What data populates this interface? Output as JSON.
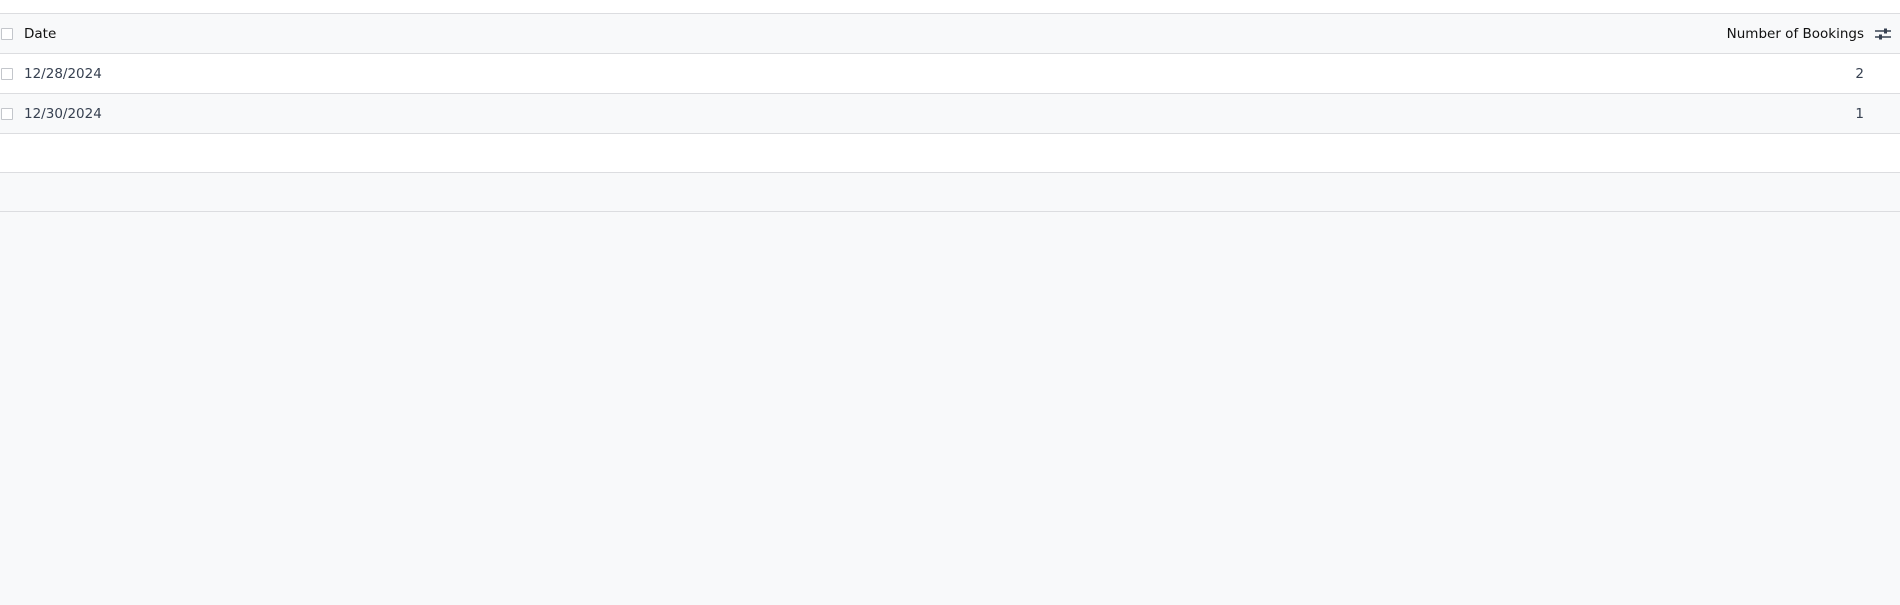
{
  "table": {
    "columns": {
      "date": "Date",
      "bookings": "Number of Bookings"
    },
    "rows": [
      {
        "date": "12/28/2024",
        "bookings": "2"
      },
      {
        "date": "12/30/2024",
        "bookings": "1"
      }
    ]
  },
  "icons": {
    "header_select": "checkbox-icon",
    "column_options": "sliders-icon"
  },
  "colors": {
    "background": "#f8f9fa",
    "row_white": "#ffffff",
    "border": "#dcdde0"
  }
}
